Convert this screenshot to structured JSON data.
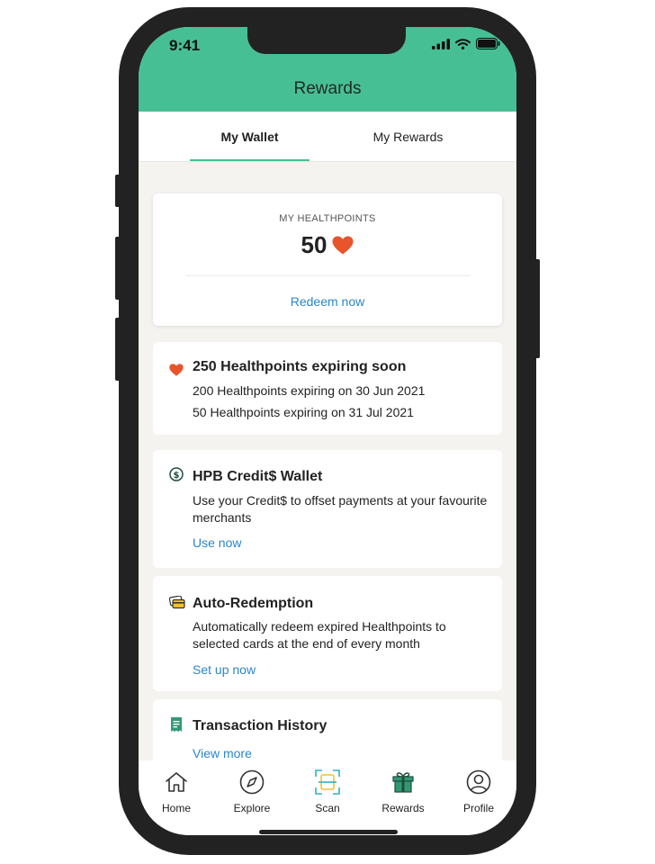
{
  "status_bar": {
    "time": "9:41"
  },
  "header": {
    "title": "Rewards"
  },
  "tabs": [
    {
      "label": "My Wallet",
      "active": true
    },
    {
      "label": "My Rewards",
      "active": false
    }
  ],
  "healthpoints": {
    "label": "MY HEALTHPOINTS",
    "value": "50",
    "redeem_label": "Redeem now"
  },
  "expiring": {
    "icon": "heart-icon",
    "title": "250 Healthpoints expiring soon",
    "lines": [
      "200 Healthpoints expiring on 30 Jun 2021",
      "50 Healthpoints expiring on 31 Jul 2021"
    ]
  },
  "credit_wallet": {
    "icon": "dollar-coin-icon",
    "title": "HPB Credit$ Wallet",
    "text": "Use your Credit$ to offset payments at your favourite merchants",
    "link": "Use now"
  },
  "auto_redemption": {
    "icon": "cards-icon",
    "title": "Auto-Redemption",
    "text": "Automatically redeem expired Healthpoints to selected cards at the end of every month",
    "link": "Set up now"
  },
  "transaction_history": {
    "icon": "receipt-icon",
    "title": "Transaction History",
    "link": "View more"
  },
  "nav": [
    {
      "label": "Home",
      "icon": "home-icon"
    },
    {
      "label": "Explore",
      "icon": "compass-icon"
    },
    {
      "label": "Scan",
      "icon": "scan-icon"
    },
    {
      "label": "Rewards",
      "icon": "gift-icon"
    },
    {
      "label": "Profile",
      "icon": "profile-icon"
    }
  ],
  "colors": {
    "brand_green": "#47bf94",
    "heart_orange": "#e8542b",
    "link_blue": "#2b86c8",
    "scan_yellow": "#f2c230",
    "scan_teal": "#2ab3c9"
  }
}
